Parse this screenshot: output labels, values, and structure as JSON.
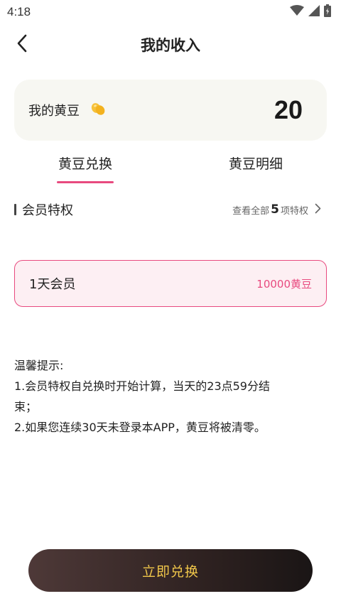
{
  "status": {
    "time": "4:18",
    "icons": [
      "wifi-icon",
      "cell-signal-icon",
      "battery-icon"
    ]
  },
  "header": {
    "title": "我的收入",
    "back_icon": "chevron-left-icon"
  },
  "balance": {
    "label": "我的黄豆",
    "icon": "bean-icon",
    "value": "20"
  },
  "tabs": [
    {
      "label": "黄豆兑换",
      "active": true
    },
    {
      "label": "黄豆明细",
      "active": false
    }
  ],
  "section": {
    "title": "会员特权",
    "view_all_prefix": "查看全部",
    "view_all_count": "5",
    "view_all_suffix": "项特权"
  },
  "plans": [
    {
      "name": "1天会员",
      "price": "10000黄豆",
      "selected": true
    }
  ],
  "tips": {
    "title": "温馨提示:",
    "line_1": "1.会员特权自兑换时开始计算，当天的23点59分结束；",
    "line_2": "2.如果您连续30天未登录本APP，黄豆将被清零。"
  },
  "cta": {
    "label": "立即兑换"
  },
  "colors": {
    "accent": "#e84a7f",
    "cta_text": "#f1c74a",
    "cta_bg": "#2f2221",
    "card_bg": "#f7f7f2",
    "plan_bg": "#fdeff3"
  }
}
